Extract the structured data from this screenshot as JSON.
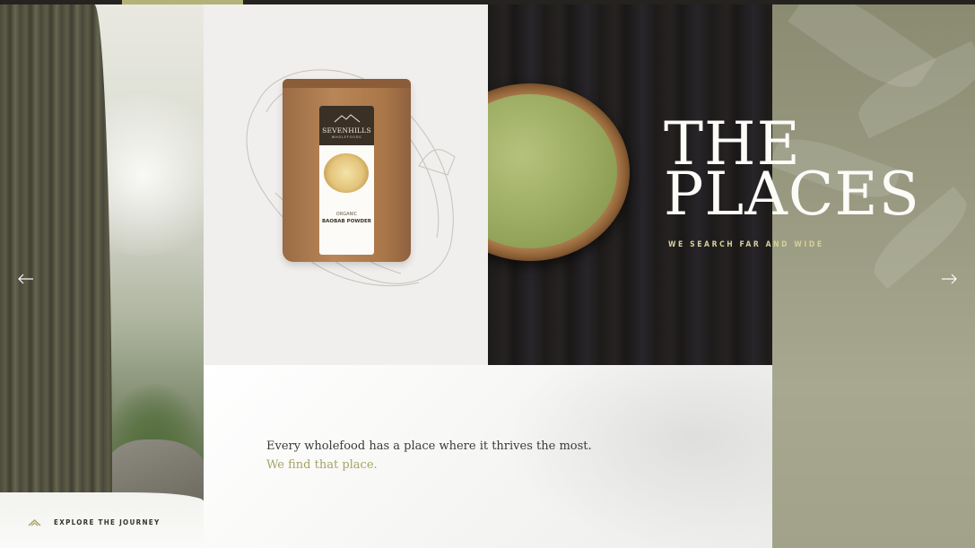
{
  "slider": {
    "progress_fraction": 0.125
  },
  "hero": {
    "title_line1": "THE",
    "title_line2": "PLACES",
    "subtitle": "WE SEARCH FAR AND WIDE"
  },
  "product": {
    "brand": "SEVENHILLS",
    "brand_sub": "WHOLEFOODS",
    "organic": "ORGANIC",
    "name": "BAOBAB POWDER"
  },
  "intro": {
    "line1": "Every wholefood has a place where it thrives the most.",
    "line2": "We find that place."
  },
  "footer": {
    "explore_label": "EXPLORE THE JOURNEY"
  },
  "icons": {
    "prev": "arrow-left-icon",
    "next": "arrow-right-icon",
    "explore": "mountain-icon"
  },
  "colors": {
    "accent": "#a5a463",
    "subtitle": "#d4d19b",
    "dark": "#24231f"
  }
}
